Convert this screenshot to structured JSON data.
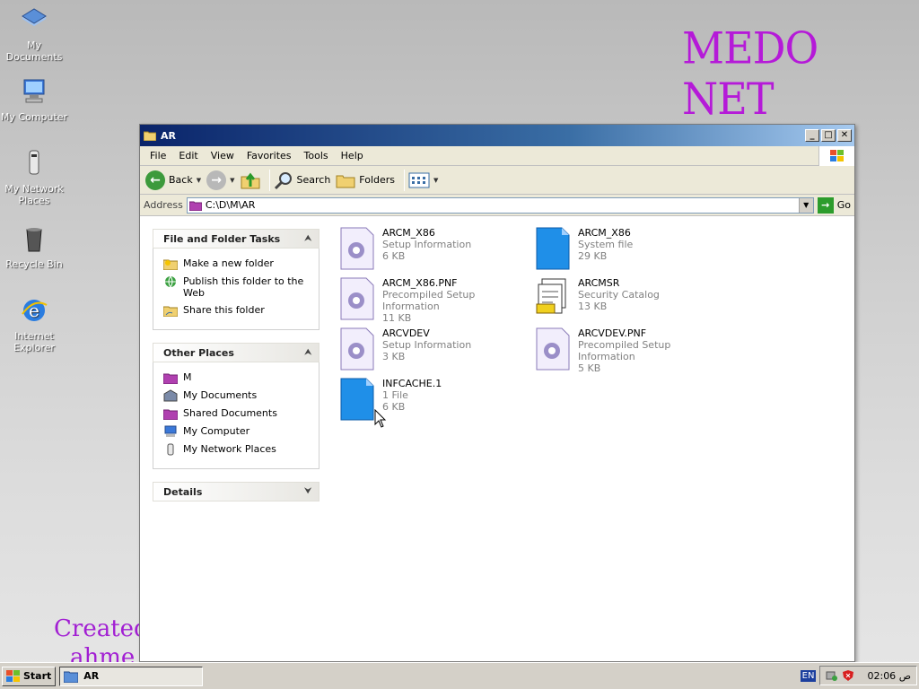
{
  "desktop": {
    "icons": [
      {
        "label": "My Documents"
      },
      {
        "label": "My Computer"
      },
      {
        "label": "My Network Places"
      },
      {
        "label": "Recycle Bin"
      },
      {
        "label": "Internet Explorer"
      }
    ],
    "watermark_brand": "MEDO NET",
    "watermark_created": "Created",
    "watermark_created2": "ahme"
  },
  "window": {
    "title": "AR",
    "menu": [
      "File",
      "Edit",
      "View",
      "Favorites",
      "Tools",
      "Help"
    ],
    "toolbar": {
      "back": "Back",
      "search": "Search",
      "folders": "Folders"
    },
    "address": {
      "label": "Address",
      "value": "C:\\D\\M\\AR",
      "go": "Go"
    },
    "panels": {
      "file_tasks": {
        "title": "File and Folder Tasks",
        "items": [
          "Make a new folder",
          "Publish this folder to the Web",
          "Share this folder"
        ]
      },
      "other_places": {
        "title": "Other Places",
        "items": [
          "M",
          "My Documents",
          "Shared Documents",
          "My Computer",
          "My Network Places"
        ]
      },
      "details": {
        "title": "Details"
      }
    },
    "files": [
      {
        "name": "ARCM_X86",
        "type": "Setup Information",
        "size": "6 KB",
        "icon": "setup-info-icon"
      },
      {
        "name": "ARCM_X86",
        "type": "System file",
        "size": "29 KB",
        "icon": "system-file-icon"
      },
      {
        "name": "ARCM_X86.PNF",
        "type": "Precompiled Setup Information",
        "size": "11 KB",
        "icon": "setup-info-icon"
      },
      {
        "name": "ARCMSR",
        "type": "Security Catalog",
        "size": "13 KB",
        "icon": "security-catalog-icon"
      },
      {
        "name": "ARCVDEV",
        "type": "Setup Information",
        "size": "3 KB",
        "icon": "setup-info-icon"
      },
      {
        "name": "ARCVDEV.PNF",
        "type": "Precompiled Setup Information",
        "size": "5 KB",
        "icon": "setup-info-icon"
      },
      {
        "name": "INFCACHE.1",
        "type": "1 File",
        "size": "6 KB",
        "icon": "system-file-icon"
      }
    ]
  },
  "taskbar": {
    "start": "Start",
    "task": "AR",
    "language": "EN",
    "clock": "02:06 ﺹ"
  }
}
